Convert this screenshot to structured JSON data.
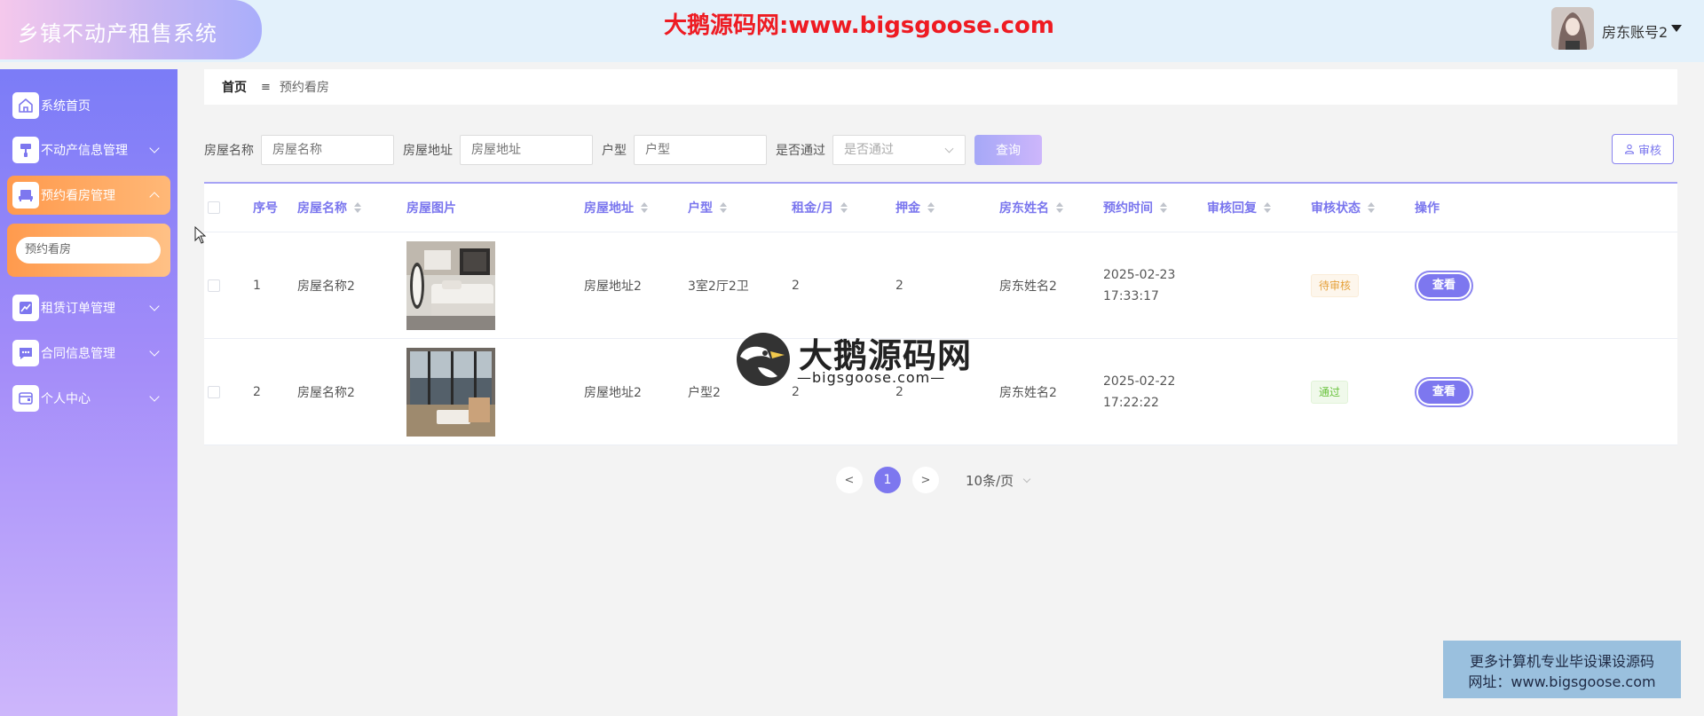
{
  "header": {
    "app_title": "乡镇不动产租售系统",
    "banner": "大鹅源码网:www.bigsgoose.com",
    "user_name": "房东账号2"
  },
  "sidebar": {
    "items": [
      {
        "label": "系统首页",
        "icon": "home-icon"
      },
      {
        "label": "不动产信息管理",
        "icon": "paint-roller-icon"
      },
      {
        "label": "预约看房管理",
        "icon": "sofa-icon",
        "active": true
      },
      {
        "label": "租赁订单管理",
        "icon": "chart-icon"
      },
      {
        "label": "合同信息管理",
        "icon": "chat-icon"
      },
      {
        "label": "个人中心",
        "icon": "wallet-icon"
      }
    ],
    "submenu": {
      "label": "预约看房"
    }
  },
  "breadcrumb": {
    "home": "首页",
    "separator": "≡",
    "current": "预约看房"
  },
  "filters": {
    "house_name": {
      "label": "房屋名称",
      "placeholder": "房屋名称"
    },
    "house_address": {
      "label": "房屋地址",
      "placeholder": "房屋地址"
    },
    "house_type": {
      "label": "户型",
      "placeholder": "户型"
    },
    "passed": {
      "label": "是否通过",
      "placeholder": "是否通过"
    },
    "query_button": "查询",
    "audit_button": "审核"
  },
  "table": {
    "columns": [
      "序号",
      "房屋名称",
      "房屋图片",
      "房屋地址",
      "户型",
      "租金/月",
      "押金",
      "房东姓名",
      "预约时间",
      "审核回复",
      "审核状态",
      "操作"
    ],
    "rows": [
      {
        "index": "1",
        "name": "房屋名称2",
        "address": "房屋地址2",
        "type": "3室2厅2卫",
        "rent": "2",
        "deposit": "2",
        "landlord": "房东姓名2",
        "time": "2025-02-23 17:33:17",
        "reply": "",
        "status": "待审核",
        "action": "查看"
      },
      {
        "index": "2",
        "name": "房屋名称2",
        "address": "房屋地址2",
        "type": "户型2",
        "rent": "2",
        "deposit": "2",
        "landlord": "房东姓名2",
        "time": "2025-02-22 17:22:22",
        "reply": "",
        "status": "通过",
        "action": "查看"
      }
    ]
  },
  "pagination": {
    "prev": "<",
    "current": "1",
    "next": ">",
    "page_size": "10条/页"
  },
  "watermark": {
    "title": "大鹅源码网",
    "subtitle": "—bigsgoose.com—"
  },
  "promo": {
    "line1": "更多计算机专业毕设课设源码",
    "line2": "网址：www.bigsgoose.com"
  },
  "colors": {
    "accent": "#7d77ef",
    "active_menu": "#ff9a4d",
    "banner_red": "#ee1b22"
  }
}
